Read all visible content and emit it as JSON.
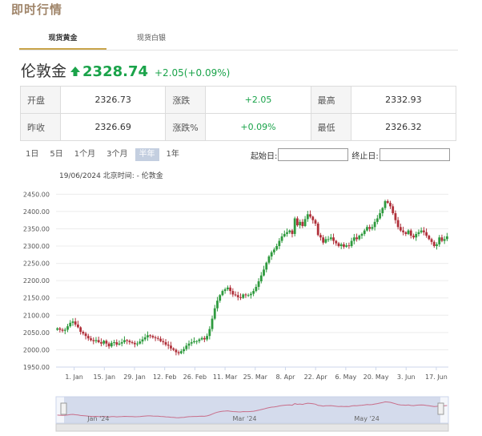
{
  "page": {
    "title": "即时行情"
  },
  "tabs": [
    {
      "label": "现货黄金"
    },
    {
      "label": "现货白银"
    }
  ],
  "quote": {
    "name": "伦敦金",
    "price": "2328.74",
    "change": "+2.05(+0.09%)",
    "color_up": "#1aa34a"
  },
  "stats": {
    "row1": [
      {
        "label": "开盘",
        "value": "2326.73"
      },
      {
        "label": "涨跌",
        "value": "+2.05"
      },
      {
        "label": "最高",
        "value": "2332.93"
      }
    ],
    "row2": [
      {
        "label": "昨收",
        "value": "2326.69"
      },
      {
        "label": "涨跌%",
        "value": "+0.09%"
      },
      {
        "label": "最低",
        "value": "2326.32"
      }
    ]
  },
  "ranges": [
    "1日",
    "5日",
    "1个月",
    "3个月",
    "半年",
    "1年"
  ],
  "active_range": "半年",
  "date_filter": {
    "start_label": "起始日:",
    "end_label": "终止日:",
    "start_value": "",
    "end_value": ""
  },
  "chart_subtitle": "19/06/2024 北京时间: - 伦敦金",
  "chart_data": {
    "type": "candlestick",
    "ylim": [
      1950,
      2460
    ],
    "y_ticks": [
      "1950.00",
      "2000.00",
      "2050.00",
      "2100.00",
      "2150.00",
      "2200.00",
      "2250.00",
      "2300.00",
      "2350.00",
      "2400.00",
      "2450.00"
    ],
    "x_ticks": [
      "1. Jan",
      "15. Jan",
      "29. Jan",
      "12. Feb",
      "26. Feb",
      "11. Mar",
      "25. Mar",
      "8. Apr",
      "22. Apr",
      "6. May",
      "20. May",
      "3. Jun",
      "17. Jun"
    ],
    "navigator_labels": [
      "Jan '24",
      "Mar '24",
      "May '24"
    ],
    "up_color": "#2e9a3e",
    "down_color": "#b0303a",
    "closes": [
      2062,
      2058,
      2055,
      2058,
      2068,
      2078,
      2082,
      2073,
      2065,
      2052,
      2047,
      2040,
      2033,
      2028,
      2025,
      2028,
      2022,
      2018,
      2026,
      2018,
      2010,
      2020,
      2022,
      2015,
      2018,
      2022,
      2028,
      2026,
      2022,
      2020,
      2016,
      2018,
      2024,
      2030,
      2036,
      2042,
      2040,
      2036,
      2034,
      2032,
      2025,
      2022,
      2015,
      2012,
      2004,
      2000,
      1993,
      1990,
      1996,
      2002,
      2012,
      2018,
      2022,
      2025,
      2025,
      2030,
      2034,
      2030,
      2040,
      2060,
      2090,
      2120,
      2142,
      2158,
      2170,
      2175,
      2180,
      2170,
      2160,
      2158,
      2152,
      2150,
      2160,
      2158,
      2158,
      2162,
      2170,
      2182,
      2198,
      2215,
      2232,
      2252,
      2270,
      2282,
      2290,
      2300,
      2315,
      2328,
      2335,
      2340,
      2345,
      2335,
      2380,
      2360,
      2370,
      2358,
      2378,
      2392,
      2385,
      2375,
      2365,
      2332,
      2325,
      2310,
      2320,
      2320,
      2325,
      2315,
      2308,
      2300,
      2305,
      2298,
      2302,
      2300,
      2315,
      2325,
      2320,
      2330,
      2335,
      2345,
      2355,
      2350,
      2355,
      2370,
      2380,
      2395,
      2410,
      2430,
      2425,
      2415,
      2395,
      2375,
      2355,
      2345,
      2340,
      2335,
      2345,
      2330,
      2325,
      2335,
      2340,
      2345,
      2340,
      2330,
      2320,
      2312,
      2300,
      2305,
      2325,
      2315,
      2320,
      2328
    ]
  }
}
